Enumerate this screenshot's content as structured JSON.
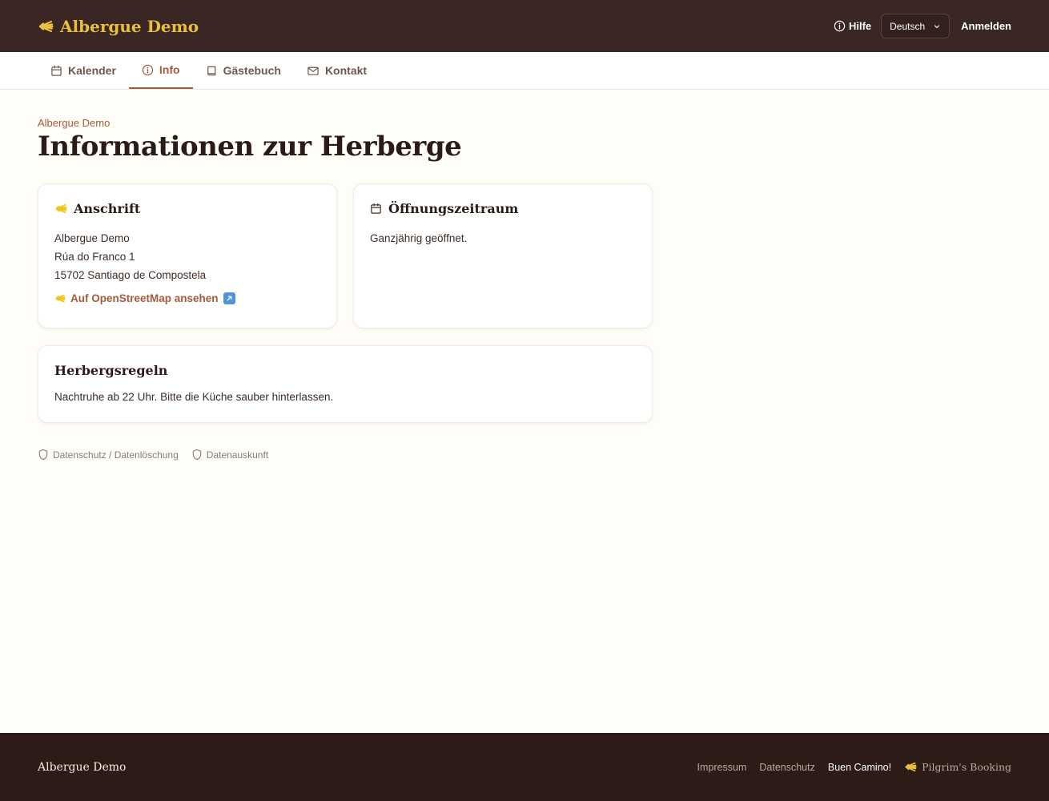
{
  "header": {
    "brand": "Albergue Demo",
    "help_label": "Hilfe",
    "language": "Deutsch",
    "login_label": "Anmelden"
  },
  "tabs": [
    {
      "label": "Kalender",
      "icon": "calendar-icon"
    },
    {
      "label": "Info",
      "icon": "info-icon",
      "active": true
    },
    {
      "label": "Gästebuch",
      "icon": "book-icon"
    },
    {
      "label": "Kontakt",
      "icon": "mail-icon"
    }
  ],
  "page": {
    "eyebrow": "Albergue Demo",
    "title": "Informationen zur Herberge"
  },
  "address_card": {
    "title": "Anschrift",
    "lines": [
      "Albergue Demo",
      "Rúa do Franco 1",
      "15702 Santiago de Compostela"
    ],
    "map_link": "Auf OpenStreetMap ansehen"
  },
  "opening_card": {
    "title": "Öffnungszeitraum",
    "text": "Ganzjährig geöffnet."
  },
  "rules_card": {
    "title": "Herbergsregeln",
    "text": "Nachtruhe ab 22 Uhr. Bitte die Küche sauber hinterlassen."
  },
  "legal_links": [
    "Datenschutz / Datenlöschung",
    "Datenauskunft"
  ],
  "footer": {
    "name": "Albergue Demo",
    "links": [
      "Impressum",
      "Datenschutz"
    ],
    "greeting": "Buen Camino!",
    "powered_by": "Pilgrim's Booking"
  },
  "colors": {
    "topbar": "#3a2622",
    "accent": "#a45a3e",
    "brand_gold": "#e9bf42",
    "page_bg": "#fffdf8",
    "footer": "#2c1b17"
  }
}
